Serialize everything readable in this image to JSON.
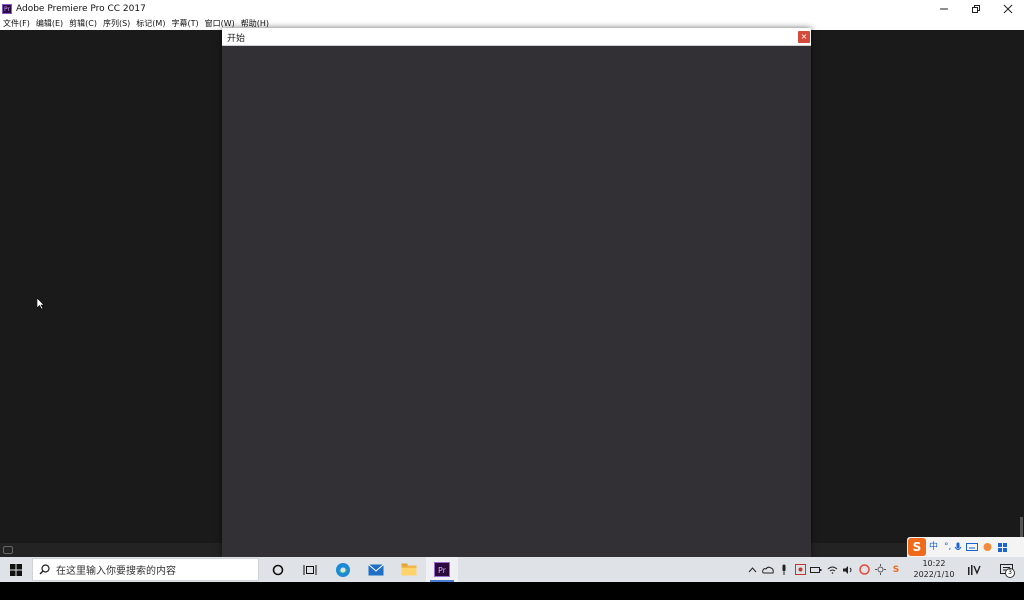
{
  "window": {
    "app_icon_text": "Pr",
    "title": "Adobe Premiere Pro CC 2017"
  },
  "menu": {
    "items": [
      {
        "label": "文件(F)"
      },
      {
        "label": "编辑(E)"
      },
      {
        "label": "剪辑(C)"
      },
      {
        "label": "序列(S)"
      },
      {
        "label": "标记(M)"
      },
      {
        "label": "字幕(T)"
      },
      {
        "label": "窗口(W)"
      },
      {
        "label": "帮助(H)"
      }
    ]
  },
  "dialog": {
    "title": "开始",
    "close_label": "×",
    "background_color": "#323034"
  },
  "ime": {
    "logo": "S",
    "mode": "中",
    "punct": "°,"
  },
  "taskbar": {
    "search_placeholder": "在这里输入你要搜索的内容",
    "pinned_apps": [
      {
        "name": "cortana-icon"
      },
      {
        "name": "task-view-icon"
      },
      {
        "name": "edge-icon"
      },
      {
        "name": "mail-icon"
      },
      {
        "name": "file-explorer-icon"
      },
      {
        "name": "premiere-pro-icon",
        "label": "Pr",
        "active": true
      }
    ],
    "ime_tray_text": "S",
    "clock": {
      "time": "10:22",
      "date": "2022/1/10"
    },
    "notification_count": "3"
  },
  "colors": {
    "workspace": "#1a1a1a",
    "taskbar": "#dfe2e7",
    "close_red": "#d34b3b",
    "premiere_purple": "#2a0b3b"
  }
}
